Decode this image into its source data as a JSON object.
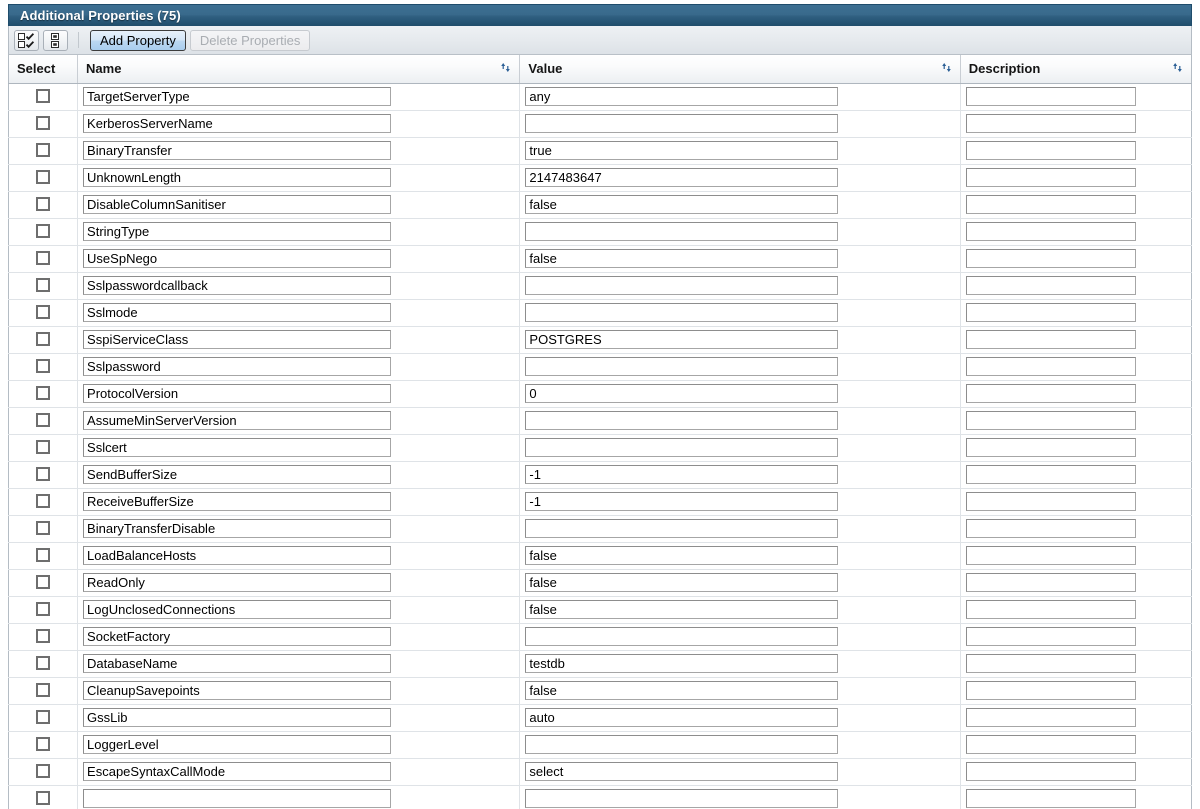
{
  "panel": {
    "title": "Additional Properties (75)",
    "count": 75
  },
  "toolbar": {
    "select_all_icon": "checkbox-grid-icon",
    "deselect_all_icon": "grid-icon",
    "add_property_label": "Add Property",
    "delete_properties_label": "Delete Properties",
    "delete_properties_enabled": false
  },
  "table": {
    "columns": [
      {
        "label": "Select",
        "sortable": false
      },
      {
        "label": "Name",
        "sortable": true
      },
      {
        "label": "Value",
        "sortable": true
      },
      {
        "label": "Description",
        "sortable": true
      }
    ],
    "sort_icon": "sort-arrows-icon",
    "rows": [
      {
        "selected": false,
        "name": "TargetServerType",
        "value": "any",
        "description": ""
      },
      {
        "selected": false,
        "name": "KerberosServerName",
        "value": "",
        "description": ""
      },
      {
        "selected": false,
        "name": "BinaryTransfer",
        "value": "true",
        "description": ""
      },
      {
        "selected": false,
        "name": "UnknownLength",
        "value": "2147483647",
        "description": ""
      },
      {
        "selected": false,
        "name": "DisableColumnSanitiser",
        "value": "false",
        "description": ""
      },
      {
        "selected": false,
        "name": "StringType",
        "value": "",
        "description": ""
      },
      {
        "selected": false,
        "name": "UseSpNego",
        "value": "false",
        "description": ""
      },
      {
        "selected": false,
        "name": "Sslpasswordcallback",
        "value": "",
        "description": ""
      },
      {
        "selected": false,
        "name": "Sslmode",
        "value": "",
        "description": ""
      },
      {
        "selected": false,
        "name": "SspiServiceClass",
        "value": "POSTGRES",
        "description": ""
      },
      {
        "selected": false,
        "name": "Sslpassword",
        "value": "",
        "description": ""
      },
      {
        "selected": false,
        "name": "ProtocolVersion",
        "value": "0",
        "description": ""
      },
      {
        "selected": false,
        "name": "AssumeMinServerVersion",
        "value": "",
        "description": ""
      },
      {
        "selected": false,
        "name": "Sslcert",
        "value": "",
        "description": ""
      },
      {
        "selected": false,
        "name": "SendBufferSize",
        "value": "-1",
        "description": ""
      },
      {
        "selected": false,
        "name": "ReceiveBufferSize",
        "value": "-1",
        "description": ""
      },
      {
        "selected": false,
        "name": "BinaryTransferDisable",
        "value": "",
        "description": ""
      },
      {
        "selected": false,
        "name": "LoadBalanceHosts",
        "value": "false",
        "description": ""
      },
      {
        "selected": false,
        "name": "ReadOnly",
        "value": "false",
        "description": ""
      },
      {
        "selected": false,
        "name": "LogUnclosedConnections",
        "value": "false",
        "description": ""
      },
      {
        "selected": false,
        "name": "SocketFactory",
        "value": "",
        "description": ""
      },
      {
        "selected": false,
        "name": "DatabaseName",
        "value": "testdb",
        "description": ""
      },
      {
        "selected": false,
        "name": "CleanupSavepoints",
        "value": "false",
        "description": ""
      },
      {
        "selected": false,
        "name": "GssLib",
        "value": "auto",
        "description": ""
      },
      {
        "selected": false,
        "name": "LoggerLevel",
        "value": "",
        "description": ""
      },
      {
        "selected": false,
        "name": "EscapeSyntaxCallMode",
        "value": "select",
        "description": ""
      },
      {
        "selected": false,
        "name": "",
        "value": "",
        "description": ""
      }
    ]
  },
  "colors": {
    "titlebar_top": "#3d6f92",
    "titlebar_bottom": "#204d6b",
    "title_text": "#ffffff",
    "toolbar_bg": "#e6eaee",
    "primary_button": "#bcd8f1",
    "sort_icon": "#2b5f96",
    "grid_line": "#dfe3e7"
  }
}
